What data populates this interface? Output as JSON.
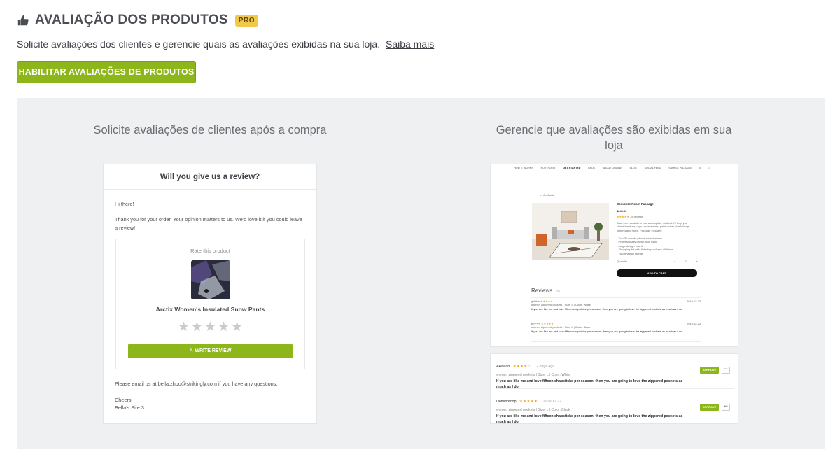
{
  "header": {
    "icon": "thumbs-up-icon",
    "title": "AVALIAÇÃO DOS PRODUTOS",
    "badge": "PRO"
  },
  "subtitle": {
    "text": "Solicite avaliações dos clientes e gerencie quais as avaliações exibidas na sua loja.",
    "link": "Saiba mais"
  },
  "enable_button": "HABILITAR AVALIAÇÕES DE PRODUTOS",
  "left_col": {
    "title": "Solicite avaliações de clientes após a compra",
    "email": {
      "heading": "Will you give us a review?",
      "greeting": "Hi there!",
      "intro": "Thank you for your order. Your opinion matters to us. We'd love it if you could leave a review!",
      "rate_label": "Rate this product",
      "product_name": "Arctix Women's Insulated Snow Pants",
      "stars": 5,
      "write_button": "WRITE REVIEW",
      "contact": "Please email us at bella.zhou@strikingly.com if you have any questions.",
      "signoff": "Cheers!",
      "site": "Bella's Site 3"
    }
  },
  "right_col": {
    "title": "Gerencie que avaliações são exibidas em sua loja",
    "store": {
      "nav": [
        "HOW IT WORKS",
        "PORTFOLIO",
        "GET STARTED",
        "FAQS",
        "ABOUT LEANNE",
        "BLOG",
        "SOCIAL FEED",
        "SAMPLE PACKAGE",
        "0"
      ],
      "nav_active": "GET STARTED",
      "back": "← Go Back",
      "product_title": "Complete Room Package",
      "price": "$249.00",
      "review_count_text": "15 reviews",
      "description": "Start from scratch or use a complete method. I'll help you select furniture, rugs, accessories, paint colors, furnishings, lighting and more. Package includes:",
      "bullets": [
        "Two 30 minute phone consultations",
        "Professionally drawn floor plan",
        "Large design board",
        "Shopping list with links to purchase all items",
        "Two revision rounds"
      ],
      "quantity_label": "Quantity",
      "quantity": "1",
      "add_to_cart": "ADD TO CART",
      "reviews_title": "Reviews",
      "reviews_count": "15",
      "reviews": [
        {
          "user": "g****m",
          "date": "2019.12.23",
          "meta": "women zippered pockets | Size: L | Color: White",
          "text": "If you are like me and love fifteen chapsticks per season, then you are going to love the zippered pockets as much as I do."
        },
        {
          "user": "bp****n",
          "date": "2019.12.23",
          "meta": "women zippered pockets | Size: L | Color: Black",
          "text": "If you are like me and love fifteen chapsticks per season, then you are going to love the zippered pockets as much as I do."
        }
      ]
    },
    "admin": [
      {
        "name": "Akeelan",
        "rating": 4,
        "date": "2 days ago",
        "meta": "women zippered pockets  |  Size: L  |  Color: White",
        "text": "If you are like me and love fifteen chapsticks per season, then you are going to love the zippered pockets as much as I do.",
        "approve": "APPROVE",
        "more": "•••"
      },
      {
        "name": "Dominotoop",
        "rating": 5,
        "date": "2019.12.27",
        "meta": "women zippered pockets  |  Size: L  |  Color: Black",
        "text": "If you are like me and love fifteen chapsticks per season, then you are going to love the zippered pockets as much as I do.",
        "approve": "APPROVE",
        "more": "•••"
      }
    ]
  },
  "colors": {
    "accent_green": "#8cb61a",
    "pro_badge": "#f2c84b",
    "panel_bg": "#eff0f1",
    "star_gold": "#f0a72b"
  }
}
